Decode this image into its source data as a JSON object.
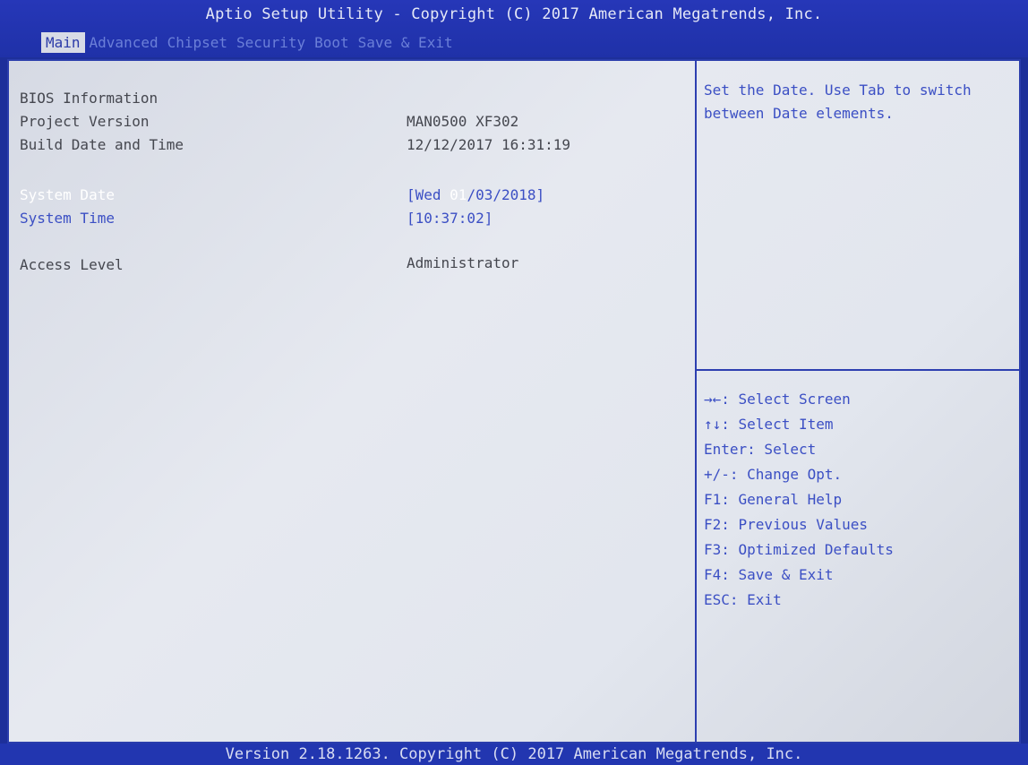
{
  "header": {
    "title": "Aptio Setup Utility - Copyright (C) 2017 American Megatrends, Inc.",
    "tabs": [
      "Main",
      "Advanced",
      "Chipset",
      "Security",
      "Boot",
      "Save & Exit"
    ],
    "active_tab": "Main"
  },
  "main": {
    "bios_info_label": "BIOS Information",
    "project_version_label": "Project Version",
    "project_version_value": "MAN0500 XF302",
    "build_date_label": "Build Date and Time",
    "build_date_value": "12/12/2017 16:31:19",
    "system_date_label": "System Date",
    "system_date_prefix": "[Wed ",
    "system_date_selected": "01",
    "system_date_suffix": "/03/2018]",
    "system_time_label": "System Time",
    "system_time_value": "[10:37:02]",
    "access_level_label": "Access Level",
    "access_level_value": "Administrator"
  },
  "help": {
    "description": "Set the Date. Use Tab to switch between Date elements.",
    "keys": [
      "→←: Select Screen",
      "↑↓: Select Item",
      "Enter: Select",
      "+/-: Change Opt.",
      "F1: General Help",
      "F2: Previous Values",
      "F3: Optimized Defaults",
      "F4: Save & Exit",
      "ESC: Exit"
    ]
  },
  "footer": {
    "text": "Version 2.18.1263. Copyright (C) 2017 American Megatrends, Inc."
  }
}
